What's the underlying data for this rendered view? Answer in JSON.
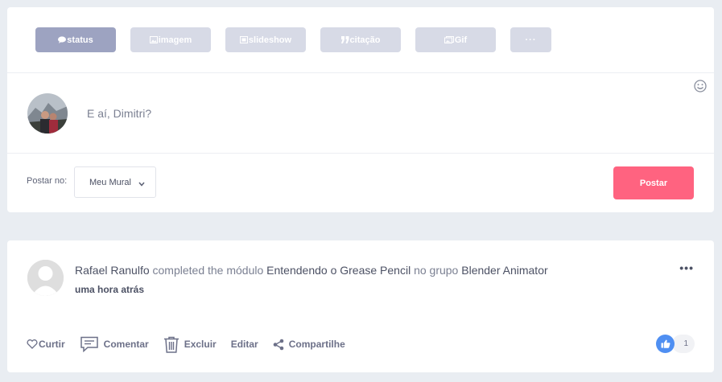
{
  "composer": {
    "tabs": [
      {
        "label": "status",
        "icon": "speech-bubble-icon",
        "active": true
      },
      {
        "label": "imagem",
        "icon": "image-icon",
        "active": false
      },
      {
        "label": "slideshow",
        "icon": "slideshow-icon",
        "active": false
      },
      {
        "label": "citação",
        "icon": "quote-icon",
        "active": false
      },
      {
        "label": "Gif",
        "icon": "gif-icon",
        "active": false
      },
      {
        "label": "···",
        "icon": "more-icon",
        "active": false
      }
    ],
    "placeholder": "E aí, Dimitri?",
    "post_to_label": "Postar no:",
    "post_to_value": "Meu Mural",
    "post_button": "Postar"
  },
  "activity": {
    "author": "Rafael Ranulfo",
    "verb1": "completed the módulo",
    "module": "Entendendo o Grease Pencil",
    "verb2": "no grupo",
    "group": "Blender Animator",
    "time": "uma hora atrás",
    "more": "•••",
    "actions": {
      "like": "Curtir",
      "comment": "Comentar",
      "delete": "Excluir",
      "edit": "Editar",
      "share": "Compartilhe"
    },
    "like_count": "1"
  },
  "colors": {
    "accent": "#ff6380",
    "tab_active": "#9da3c1",
    "tab_inactive": "#d7dae6",
    "like_blue": "#4f8ff2",
    "background": "#e9edf2"
  }
}
